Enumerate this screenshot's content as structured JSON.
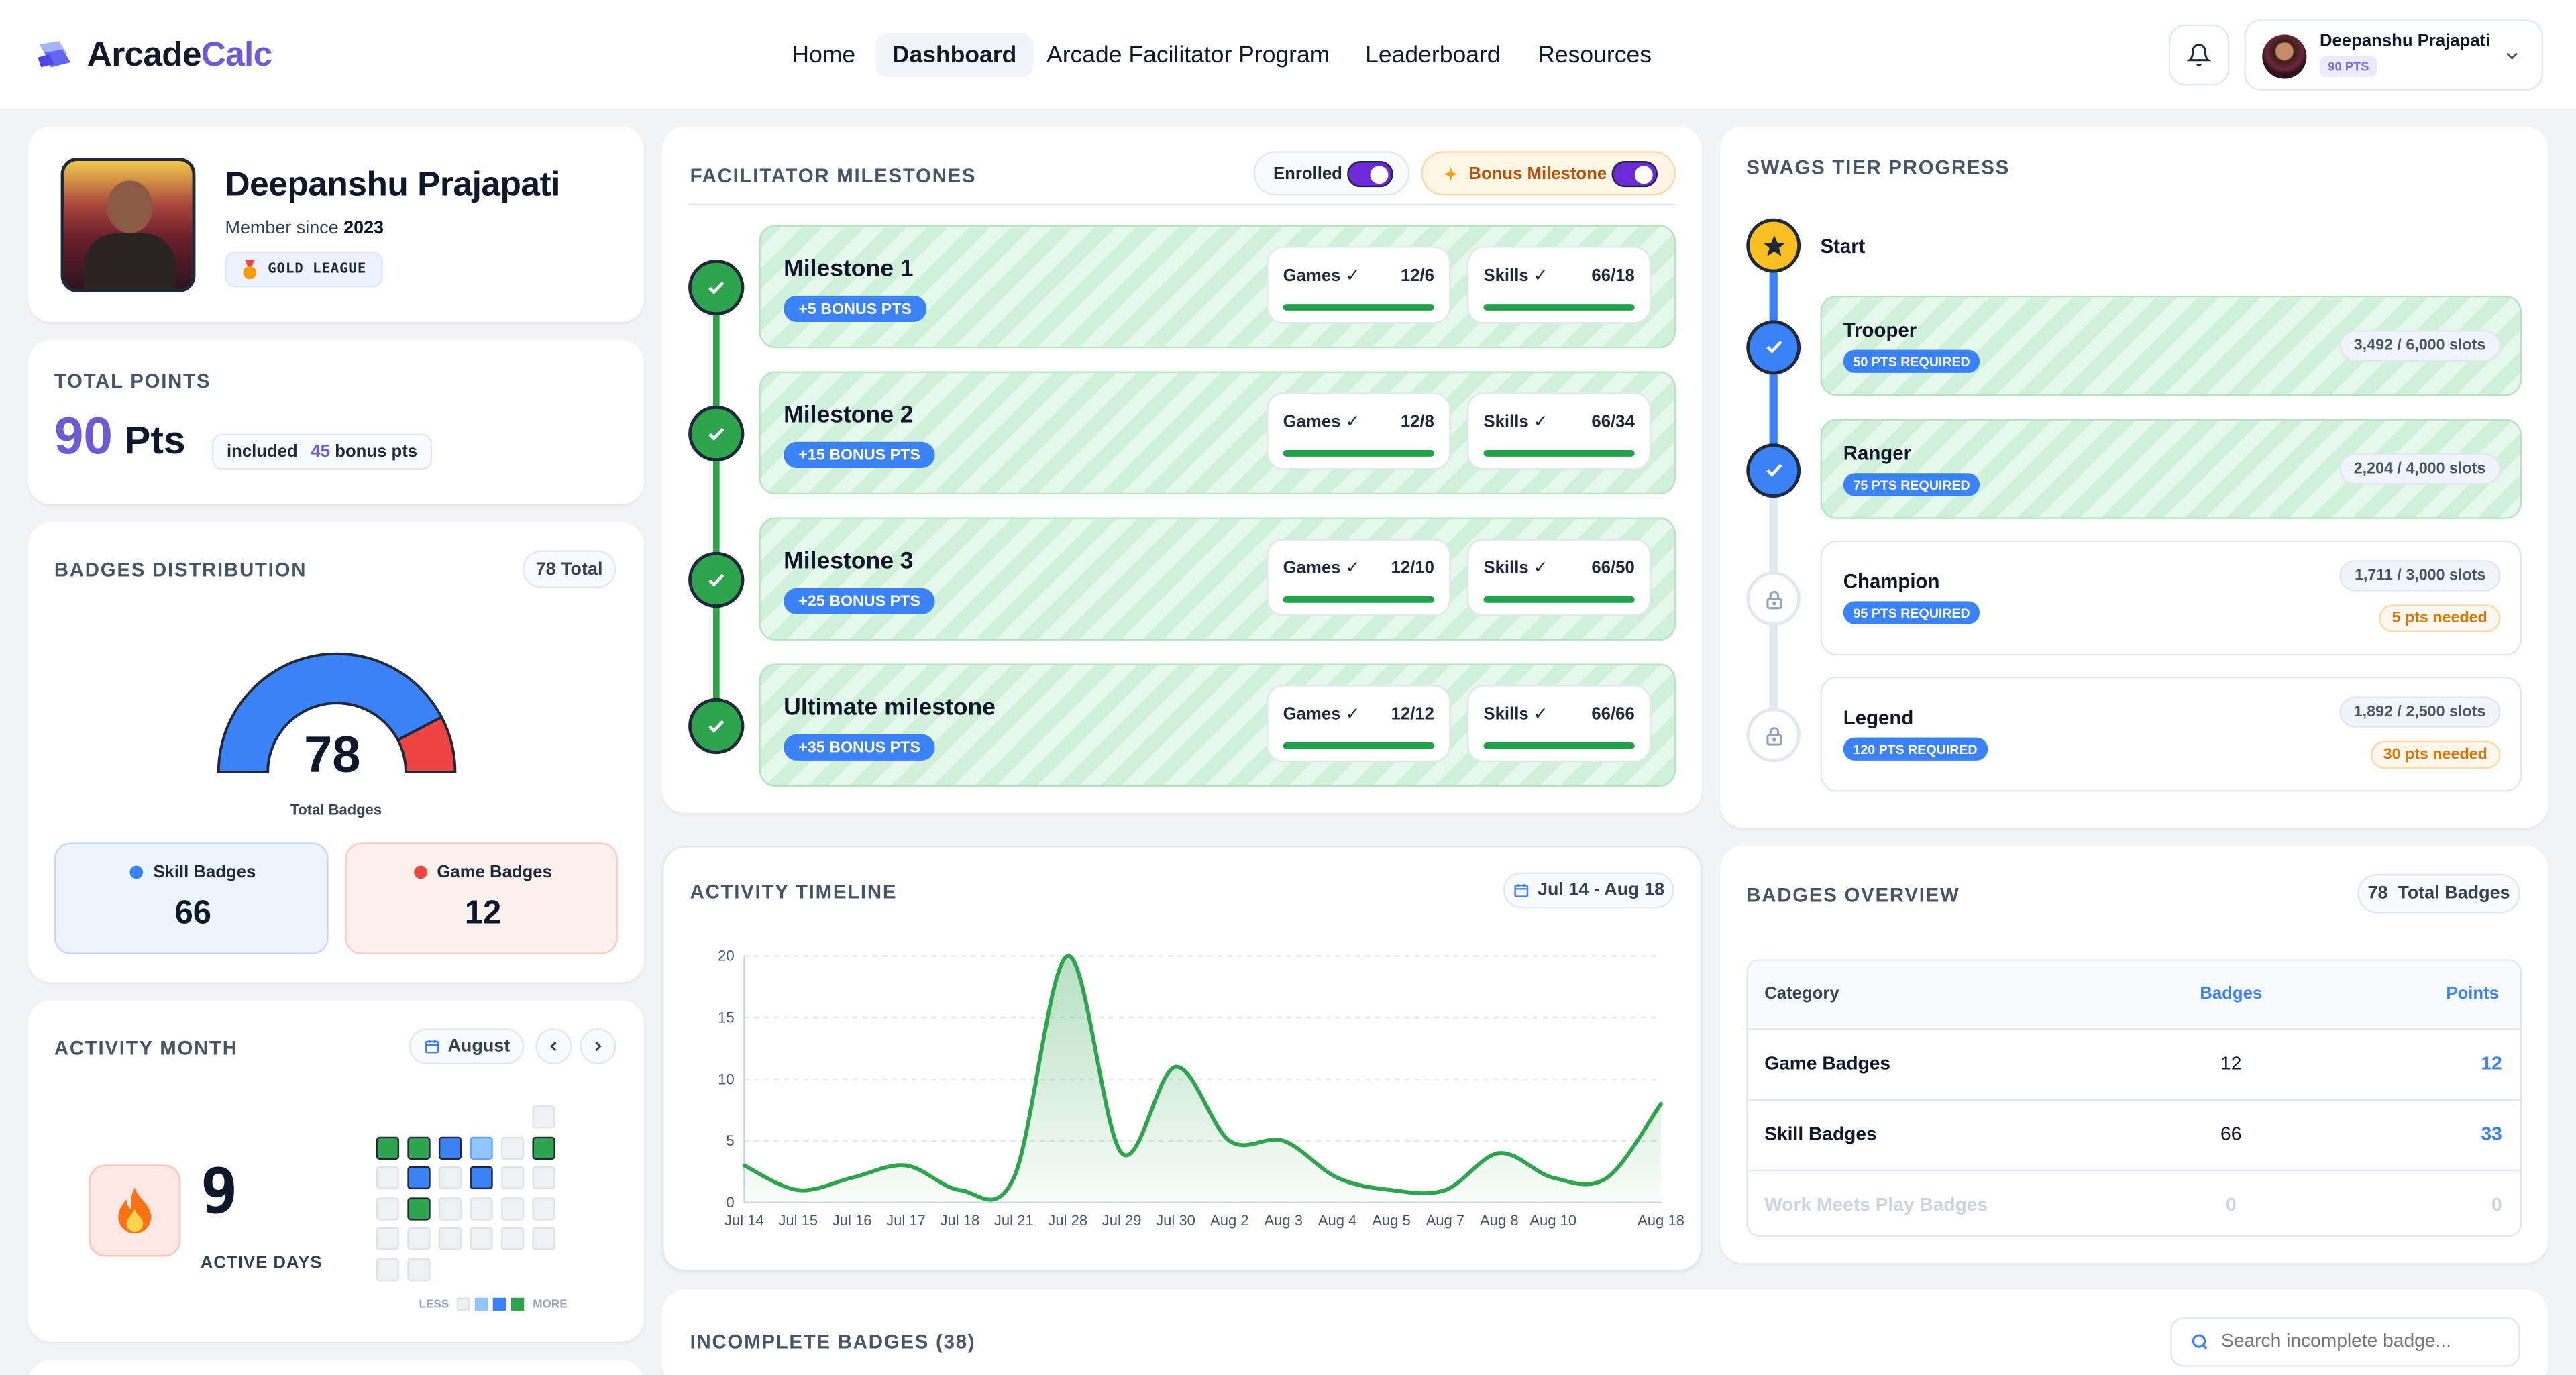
{
  "app": {
    "logo_a": "Arcade",
    "logo_b": "Calc"
  },
  "nav": {
    "items": [
      "Home",
      "Dashboard",
      "Arcade Facilitator Program",
      "Leaderboard",
      "Resources"
    ],
    "active": "Dashboard"
  },
  "user": {
    "name": "Deepanshu Prajapati",
    "pts": "90 PTS"
  },
  "profile": {
    "name": "Deepanshu Prajapati",
    "member_label": "Member since",
    "member_year": "2023",
    "league": "GOLD LEAGUE"
  },
  "points": {
    "title": "TOTAL POINTS",
    "value": "90",
    "unit": "Pts",
    "included_pre": "included",
    "included_num": "45",
    "included_post": "bonus pts"
  },
  "badges_dist": {
    "title": "BADGES DISTRIBUTION",
    "total_pill": "78 Total",
    "center_value": "78",
    "center_label": "Total Badges",
    "skill_label": "Skill Badges",
    "skill_value": "66",
    "game_label": "Game Badges",
    "game_value": "12",
    "skill_color": "#3b82f6",
    "game_color": "#ef4444"
  },
  "activity_month": {
    "title": "ACTIVITY MONTH",
    "month": "August",
    "days_value": "9",
    "days_label": "ACTIVE DAYS",
    "legend_less": "LESS",
    "legend_more": "MORE"
  },
  "milestones": {
    "title": "FACILITATOR MILESTONES",
    "enrolled_label": "Enrolled",
    "enrolled_on": true,
    "bonus_label": "Bonus Milestone",
    "bonus_on": true,
    "items": [
      {
        "title": "Milestone 1",
        "bonus": "+5 BONUS PTS",
        "games_label": "Games ✓",
        "games": "12/6",
        "skills_label": "Skills ✓",
        "skills": "66/18"
      },
      {
        "title": "Milestone 2",
        "bonus": "+15 BONUS PTS",
        "games_label": "Games ✓",
        "games": "12/8",
        "skills_label": "Skills ✓",
        "skills": "66/34"
      },
      {
        "title": "Milestone 3",
        "bonus": "+25 BONUS PTS",
        "games_label": "Games ✓",
        "games": "12/10",
        "skills_label": "Skills ✓",
        "skills": "66/50"
      },
      {
        "title": "Ultimate milestone",
        "bonus": "+35 BONUS PTS",
        "games_label": "Games ✓",
        "games": "12/12",
        "skills_label": "Skills ✓",
        "skills": "66/66"
      }
    ]
  },
  "tiers": {
    "title": "SWAGS TIER PROGRESS",
    "start": "Start",
    "items": [
      {
        "name": "Trooper",
        "req": "50 PTS REQUIRED",
        "slots": "3,492 / 6,000 slots",
        "needed": "",
        "done": true
      },
      {
        "name": "Ranger",
        "req": "75 PTS REQUIRED",
        "slots": "2,204 / 4,000 slots",
        "needed": "",
        "done": true
      },
      {
        "name": "Champion",
        "req": "95 PTS REQUIRED",
        "slots": "1,711 / 3,000 slots",
        "needed": "5 pts needed",
        "done": false
      },
      {
        "name": "Legend",
        "req": "120 PTS REQUIRED",
        "slots": "1,892 / 2,500 slots",
        "needed": "30 pts needed",
        "done": false
      }
    ]
  },
  "timeline": {
    "title": "ACTIVITY TIMELINE",
    "range": "Jul 14 - Aug 18"
  },
  "overview": {
    "title": "BADGES OVERVIEW",
    "total": "78  Total Badges",
    "col_category": "Category",
    "col_badges": "Badges",
    "col_points": "Points",
    "rows": [
      {
        "category": "Game Badges",
        "badges": "12",
        "points": "12"
      },
      {
        "category": "Skill Badges",
        "badges": "66",
        "points": "33"
      },
      {
        "category": "Work Meets Play Badges",
        "badges": "0",
        "points": "0"
      }
    ]
  },
  "incomplete": {
    "title": "INCOMPLETE BADGES (38)",
    "search_placeholder": "Search incomplete badge..."
  },
  "chart_data": {
    "type": "line",
    "x": [
      "Jul 14",
      "Jul 15",
      "Jul 16",
      "Jul 17",
      "Jul 18",
      "Jul 21",
      "Jul 28",
      "Jul 29",
      "Jul 30",
      "Aug 2",
      "Aug 3",
      "Aug 4",
      "Aug 5",
      "Aug 7",
      "Aug 8",
      "Aug 10",
      "",
      "Aug 18"
    ],
    "y": [
      3,
      1,
      2,
      3,
      1,
      2,
      20,
      4,
      11,
      5,
      5,
      2,
      1,
      1,
      4,
      2,
      2,
      8
    ],
    "yticks": [
      0,
      5,
      10,
      15,
      20
    ],
    "ylim": [
      0,
      20
    ],
    "color": "#2ea44f",
    "title": "",
    "xlabel": "",
    "ylabel": ""
  },
  "heatmap": {
    "rows": [
      [
        null,
        null,
        null,
        null,
        null,
        0
      ],
      [
        3,
        3,
        2,
        1,
        0,
        3
      ],
      [
        0,
        2,
        0,
        2,
        0,
        0
      ],
      [
        0,
        3,
        0,
        0,
        0,
        0
      ],
      [
        0,
        0,
        0,
        0,
        0,
        0
      ],
      [
        0,
        0,
        null,
        null,
        null,
        null
      ]
    ],
    "colors": [
      "#eef0f3",
      "#93c5fd",
      "#3b82f6",
      "#2ea44f"
    ]
  }
}
